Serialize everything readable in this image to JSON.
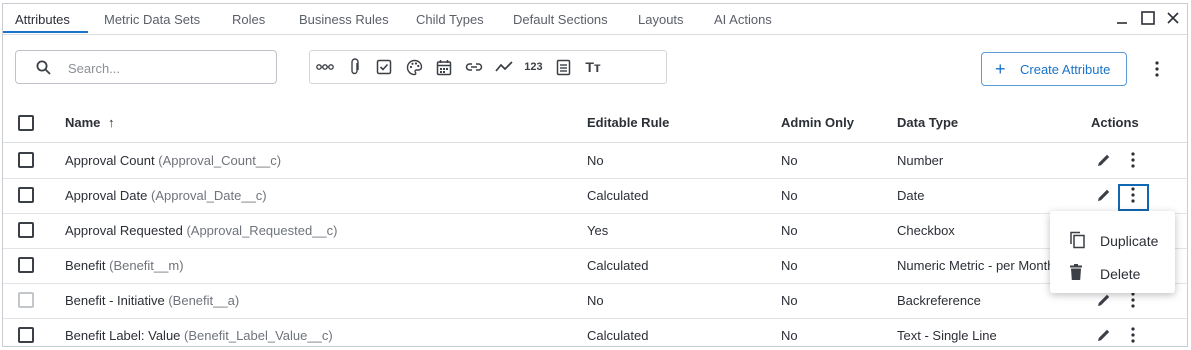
{
  "tabs": [
    {
      "label": "Attributes",
      "active": true
    },
    {
      "label": "Metric Data Sets"
    },
    {
      "label": "Roles"
    },
    {
      "label": "Business Rules"
    },
    {
      "label": "Child Types"
    },
    {
      "label": "Default Sections"
    },
    {
      "label": "Layouts"
    },
    {
      "label": "AI Actions"
    }
  ],
  "window_controls": [
    "minimize-icon",
    "maximize-icon",
    "close-icon"
  ],
  "search": {
    "placeholder": "Search...",
    "value": ""
  },
  "filter_icons": [
    "link-chain-icon",
    "attachment-icon",
    "checkbox-icon",
    "palette-icon",
    "calendar-icon",
    "hyperlink-icon",
    "trend-line-icon",
    "number-icon",
    "document-lines-icon",
    "text-type-icon"
  ],
  "filter_labels": {
    "number": "123",
    "text": "Tт"
  },
  "create_button": {
    "plus": "+",
    "label": "Create Attribute"
  },
  "table": {
    "columns": {
      "name": "Name",
      "sort": "↑",
      "editable_rule": "Editable Rule",
      "admin_only": "Admin Only",
      "data_type": "Data Type",
      "actions": "Actions"
    },
    "rows": [
      {
        "name": "Approval Count",
        "api": "(Approval_Count__c)",
        "editable_rule": "No",
        "admin_only": "No",
        "data_type": "Number",
        "checkbox_enabled": true
      },
      {
        "name": "Approval Date",
        "api": "(Approval_Date__c)",
        "editable_rule": "Calculated",
        "admin_only": "No",
        "data_type": "Date",
        "checkbox_enabled": true,
        "actions_focused": true
      },
      {
        "name": "Approval Requested",
        "api": "(Approval_Requested__c)",
        "editable_rule": "Yes",
        "admin_only": "No",
        "data_type": "Checkbox",
        "checkbox_enabled": true
      },
      {
        "name": "Benefit",
        "api": "(Benefit__m)",
        "editable_rule": "Calculated",
        "admin_only": "No",
        "data_type": "Numeric Metric - per Month",
        "checkbox_enabled": true
      },
      {
        "name": "Benefit - Initiative",
        "api": "(Benefit__a)",
        "editable_rule": "No",
        "admin_only": "No",
        "data_type": "Backreference",
        "checkbox_enabled": false
      },
      {
        "name": "Benefit Label: Value",
        "api": "(Benefit_Label_Value__c)",
        "editable_rule": "Calculated",
        "admin_only": "No",
        "data_type": "Text - Single Line",
        "checkbox_enabled": true
      }
    ]
  },
  "context_menu": {
    "items": [
      {
        "label": "Duplicate",
        "icon": "duplicate-icon"
      },
      {
        "label": "Delete",
        "icon": "trash-icon"
      }
    ]
  },
  "colors": {
    "accent": "#1a73c9",
    "focus_outline": "#1167b1",
    "border": "#c9ccd1"
  }
}
